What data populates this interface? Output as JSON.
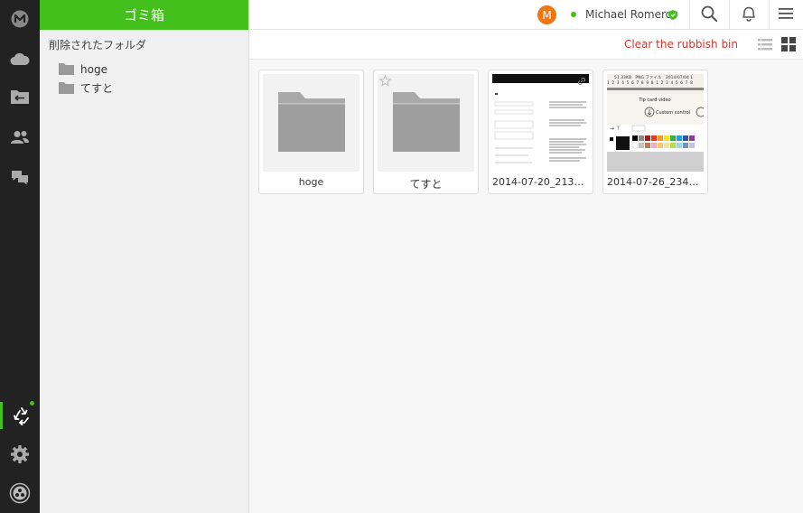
{
  "rail": {
    "items": [
      {
        "icon": "logo-m-icon"
      },
      {
        "icon": "cloud-icon"
      },
      {
        "icon": "shared-folder-icon"
      },
      {
        "icon": "users-icon"
      },
      {
        "icon": "chat-icon"
      },
      {
        "icon": "recycle-icon"
      },
      {
        "icon": "gear-icon"
      },
      {
        "icon": "app-icon"
      }
    ]
  },
  "sidebar": {
    "header": "ゴミ箱",
    "section_title": "削除されたフォルダ",
    "items": [
      {
        "label": "hoge",
        "icon": "folder-icon"
      },
      {
        "label": "てすと",
        "icon": "folder-icon"
      }
    ]
  },
  "topbar": {
    "avatar_initial": "M",
    "user_name": "Michael Romero",
    "status": "online",
    "accent": "#43c01b",
    "avatar_color": "#f0760d"
  },
  "toolbar": {
    "clear_label": "Clear the rubbish bin",
    "clear_color": "#d9352b"
  },
  "items": [
    {
      "name": "hoge",
      "type": "folder"
    },
    {
      "name": "てすと",
      "type": "folder"
    },
    {
      "name": "2014-07-20_2136…",
      "type": "image"
    },
    {
      "name": "2014-07-26_2344…",
      "type": "image"
    }
  ],
  "thumb2": {
    "header": "51.33KB　PNG ファイル　2014/07/04 1",
    "line2": "1 2 3 4 5 6 7 8 9 0 1 2 3 4 5 6 7 8",
    "title": "Tip card video",
    "button": "Custom control"
  }
}
